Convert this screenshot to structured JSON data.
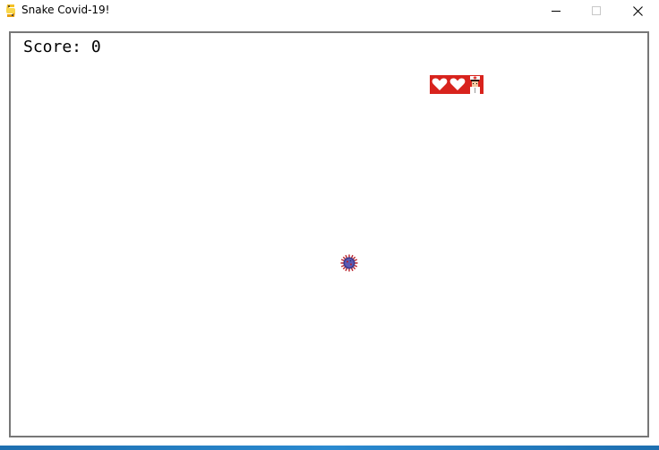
{
  "window": {
    "title": "Snake Covid-19!",
    "app_icon": "python-icon",
    "buttons": [
      "minimize-icon",
      "maximize-icon",
      "close-icon"
    ]
  },
  "game": {
    "score_label": "Score: 0",
    "score": 0,
    "lives": 2,
    "colors": {
      "border": "#777777",
      "lives_bg": "#d8231d",
      "heart": "#ffffff",
      "virus_core": "#3a3a8c",
      "virus_spikes": "#b8202a"
    }
  }
}
